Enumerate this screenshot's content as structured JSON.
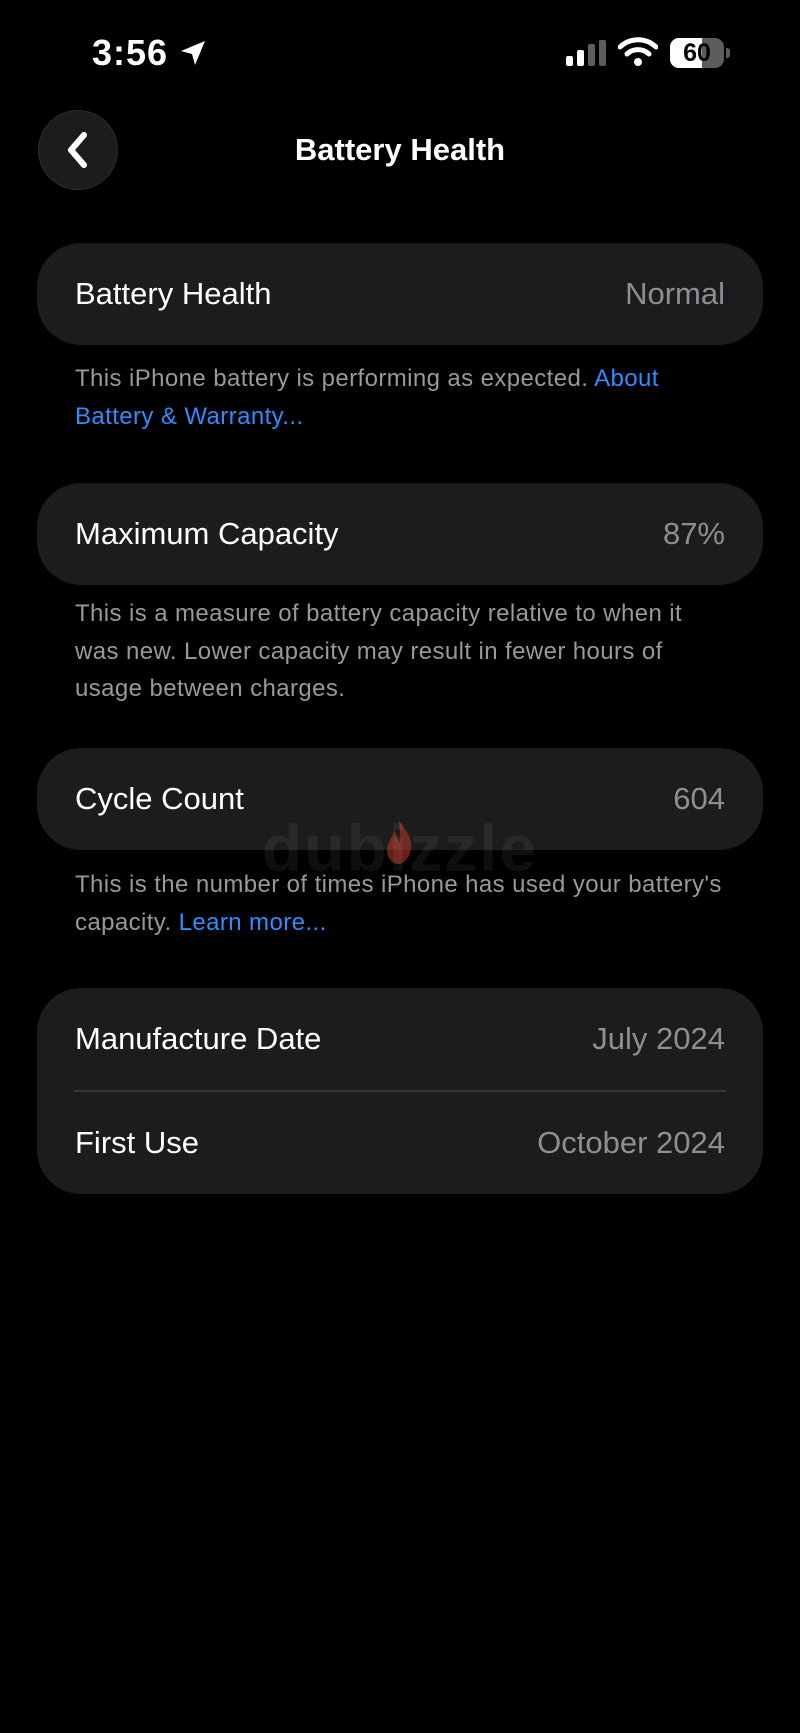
{
  "status_bar": {
    "time": "3:56",
    "battery_level": "60",
    "battery_fraction": 0.6,
    "icons": [
      "location-arrow-icon",
      "cellular-signal-icon",
      "wifi-icon",
      "battery-icon"
    ]
  },
  "nav": {
    "title": "Battery Health",
    "back_icon": "chevron-left-icon"
  },
  "sections": {
    "health": {
      "label": "Battery Health",
      "value": "Normal",
      "note": "This iPhone battery is performing as expected.",
      "link": "About Battery & Warranty..."
    },
    "capacity": {
      "label": "Maximum Capacity",
      "value": "87%",
      "note": "This is a measure of battery capacity relative to when it was new. Lower capacity may result in fewer hours of usage between charges."
    },
    "cycles": {
      "label": "Cycle Count",
      "value": "604",
      "note": "This is the number of times iPhone has used your battery's capacity.",
      "link": "Learn more..."
    },
    "dates": {
      "manufacture_label": "Manufacture Date",
      "manufacture_value": "July 2024",
      "first_use_label": "First Use",
      "first_use_value": "October 2024"
    }
  },
  "watermark": "dubizzle",
  "colors": {
    "background": "#000000",
    "card": "#1c1c1e",
    "secondary_text": "#8e8e93",
    "link": "#2f8cff",
    "watermark_flame": "#c0392b"
  }
}
